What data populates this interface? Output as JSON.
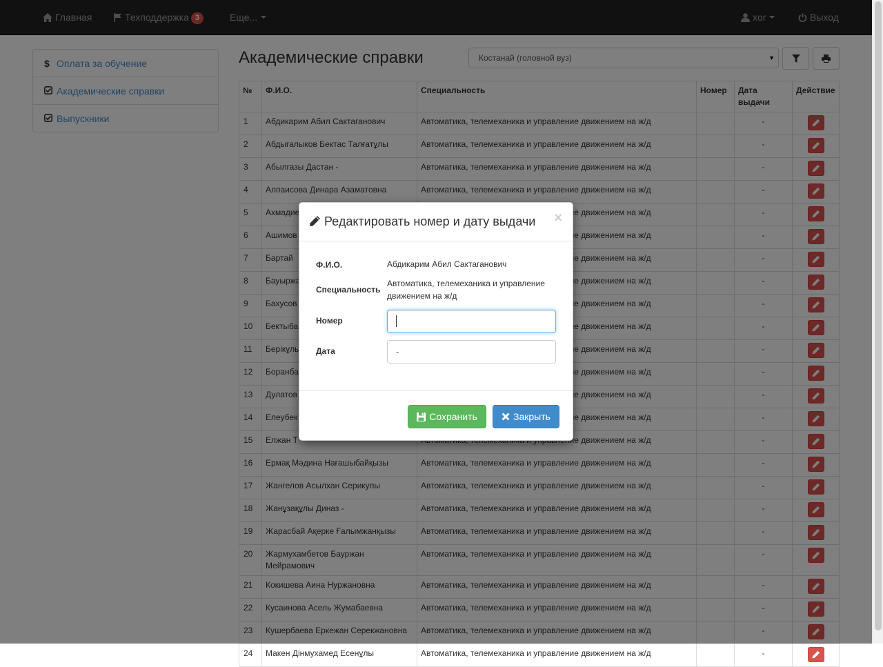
{
  "navbar": {
    "home_label": "Главная",
    "support_label": "Техподдержка",
    "support_badge": "3",
    "more_label": "Еще...",
    "user_label": "xor",
    "logout_label": "Выход"
  },
  "sidebar": {
    "items": [
      {
        "icon": "dollar-icon",
        "label": "Оплата за обучение"
      },
      {
        "icon": "check-square-icon",
        "label": "Академические справки"
      },
      {
        "icon": "check-square-icon",
        "label": "Выпускники"
      }
    ]
  },
  "main": {
    "title": "Академические справки",
    "campus_select": "Костанай (головной вуз)",
    "filter_icon": "filter-icon",
    "print_icon": "print-icon"
  },
  "table": {
    "headers": [
      "№",
      "Ф.И.О.",
      "Специальность",
      "Номер",
      "Дата выдачи",
      "Действие"
    ],
    "rows": [
      {
        "no": "1",
        "fio": "Абдикарим Абил Сактаганович",
        "spec": "Автоматика, телемеханика и управление движением на ж/д",
        "num": "",
        "date": "-"
      },
      {
        "no": "2",
        "fio": "Абдыгалыков Бектас Талғатұлы",
        "spec": "Автоматика, телемеханика и управление движением на ж/д",
        "num": "",
        "date": "-"
      },
      {
        "no": "3",
        "fio": "Абылгазы Дастан -",
        "spec": "Автоматика, телемеханика и управление движением на ж/д",
        "num": "",
        "date": "-"
      },
      {
        "no": "4",
        "fio": "Алпаисова Динара Азаматовна",
        "spec": "Автоматика, телемеханика и управление движением на ж/д",
        "num": "",
        "date": "-"
      },
      {
        "no": "5",
        "fio": "Ахмадиев Данекер Хаезулы",
        "spec": "Автоматика, телемеханика и управление движением на ж/д",
        "num": "",
        "date": "-"
      },
      {
        "no": "6",
        "fio": "Ашимов",
        "spec": "Автоматика, телемеханика и управление движением на ж/д",
        "num": "",
        "date": "-"
      },
      {
        "no": "7",
        "fio": "Бартай",
        "spec": "Автоматика, телемеханика и управление движением на ж/д",
        "num": "",
        "date": "-"
      },
      {
        "no": "8",
        "fio": "Бауыржа",
        "spec": "Автоматика, телемеханика и управление движением на ж/д",
        "num": "",
        "date": "-"
      },
      {
        "no": "9",
        "fio": "Бахусов",
        "spec": "Автоматика, телемеханика и управление движением на ж/д",
        "num": "",
        "date": "-"
      },
      {
        "no": "10",
        "fio": "Бектыба",
        "spec": "Автоматика, телемеханика и управление движением на ж/д",
        "num": "",
        "date": "-"
      },
      {
        "no": "11",
        "fio": "Берікұлы",
        "spec": "Автоматика, телемеханика и управление движением на ж/д",
        "num": "",
        "date": "-"
      },
      {
        "no": "12",
        "fio": "Боранба",
        "spec": "Автоматика, телемеханика и управление движением на ж/д",
        "num": "",
        "date": "-"
      },
      {
        "no": "13",
        "fio": "Дулатов",
        "spec": "Автоматика, телемеханика и управление движением на ж/д",
        "num": "",
        "date": "-"
      },
      {
        "no": "14",
        "fio": "Елеубек",
        "spec": "Автоматика, телемеханика и управление движением на ж/д",
        "num": "",
        "date": "-"
      },
      {
        "no": "15",
        "fio": "Елжан Т",
        "spec": "Автоматика, телемеханика и управление движением на ж/д",
        "num": "",
        "date": "-"
      },
      {
        "no": "16",
        "fio": "Ермақ Мәдина Нағашыбайқызы",
        "spec": "Автоматика, телемеханика и управление движением на ж/д",
        "num": "",
        "date": "-"
      },
      {
        "no": "17",
        "fio": "Жангелов Асылхан Серикулы",
        "spec": "Автоматика, телемеханика и управление движением на ж/д",
        "num": "",
        "date": "-"
      },
      {
        "no": "18",
        "fio": "Жанұзақұлы Диназ -",
        "spec": "Автоматика, телемеханика и управление движением на ж/д",
        "num": "",
        "date": "-"
      },
      {
        "no": "19",
        "fio": "Жарасбай Ақерке Ғалымжанқызы",
        "spec": "Автоматика, телемеханика и управление движением на ж/д",
        "num": "",
        "date": "-"
      },
      {
        "no": "20",
        "fio": "Жармухамбетов Бауржан Мейрамович",
        "spec": "Автоматика, телемеханика и управление движением на ж/д",
        "num": "",
        "date": "-"
      },
      {
        "no": "21",
        "fio": "Кокишева Аина Нуржановна",
        "spec": "Автоматика, телемеханика и управление движением на ж/д",
        "num": "",
        "date": "-"
      },
      {
        "no": "22",
        "fio": "Кусаинова Асель Жумабаевна",
        "spec": "Автоматика, телемеханика и управление движением на ж/д",
        "num": "",
        "date": "-"
      },
      {
        "no": "23",
        "fio": "Кушербаева Еркежан Серекжановна",
        "spec": "Автоматика, телемеханика и управление движением на ж/д",
        "num": "",
        "date": "-"
      },
      {
        "no": "24",
        "fio": "Макен Дінмухамед Есенұлы",
        "spec": "Автоматика, телемеханика и управление движением на ж/д",
        "num": "",
        "date": "-"
      }
    ]
  },
  "modal": {
    "title": "Редактировать номер и дату выдачи",
    "close_glyph": "×",
    "fio_label": "Ф.И.О.",
    "fio_value": "Абдикарим Абил Сактаганович",
    "spec_label": "Специальность",
    "spec_value": "Автоматика, телемеханика и управление движением на ж/д",
    "number_label": "Номер",
    "number_value": "",
    "date_label": "Дата",
    "date_value": "-",
    "save_label": "Сохранить",
    "close_label": "Закрыть"
  },
  "colors": {
    "navbar_bg": "#222222",
    "link": "#428bca",
    "danger": "#d9534f",
    "success": "#5cb85c",
    "primary": "#428bca"
  }
}
